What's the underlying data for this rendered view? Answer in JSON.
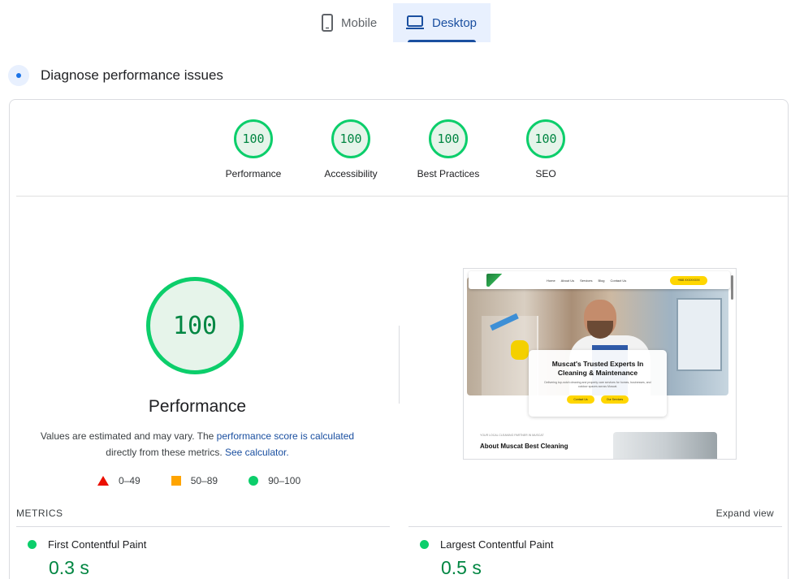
{
  "tabs": [
    {
      "label": "Mobile",
      "icon": "phone-icon",
      "selected": false
    },
    {
      "label": "Desktop",
      "icon": "laptop-icon",
      "selected": true
    }
  ],
  "diagnose": {
    "title": "Diagnose performance issues",
    "icon": "diagnose-icon"
  },
  "categories": [
    {
      "label": "Performance",
      "score": "100"
    },
    {
      "label": "Accessibility",
      "score": "100"
    },
    {
      "label": "Best Practices",
      "score": "100"
    },
    {
      "label": "SEO",
      "score": "100"
    }
  ],
  "main_gauge": {
    "score": "100",
    "title": "Performance"
  },
  "note": {
    "prefix": "Values are estimated and may vary. The ",
    "link1": "performance score is calculated",
    "middle": " directly from these metrics. ",
    "link2": "See calculator."
  },
  "legend": [
    {
      "range": "0–49",
      "color": "#eb0f00",
      "shape": "triangle"
    },
    {
      "range": "50–89",
      "color": "#ffa400",
      "shape": "square"
    },
    {
      "range": "90–100",
      "color": "#0cce6b",
      "shape": "circle"
    }
  ],
  "screenshot": {
    "nav_links": [
      "Home",
      "About Us",
      "Services",
      "Blog",
      "Contact Us"
    ],
    "call_button": "+968 XXXXXXXX",
    "hero_title_line1": "Muscat's Trusted Experts In",
    "hero_title_line2": "Cleaning & Maintenance",
    "hero_sub": "Delivering top-notch cleaning and property care services for homes, businesses, and outdoor spaces across Muscat.",
    "btn1": "Contact Us",
    "btn2": "Our Services",
    "section_tag": "YOUR LOCAL CLEANING PARTNER IN MUSCAT",
    "section_title": "About Muscat Best Cleaning"
  },
  "metrics": {
    "label": "METRICS",
    "expand": "Expand view",
    "items": [
      {
        "name": "First Contentful Paint",
        "value": "0.3 s"
      },
      {
        "name": "Largest Contentful Paint",
        "value": "0.5 s"
      }
    ]
  },
  "colors": {
    "good": "#0cce6b",
    "good_text": "#018642",
    "accent": "#1a4fa0"
  }
}
